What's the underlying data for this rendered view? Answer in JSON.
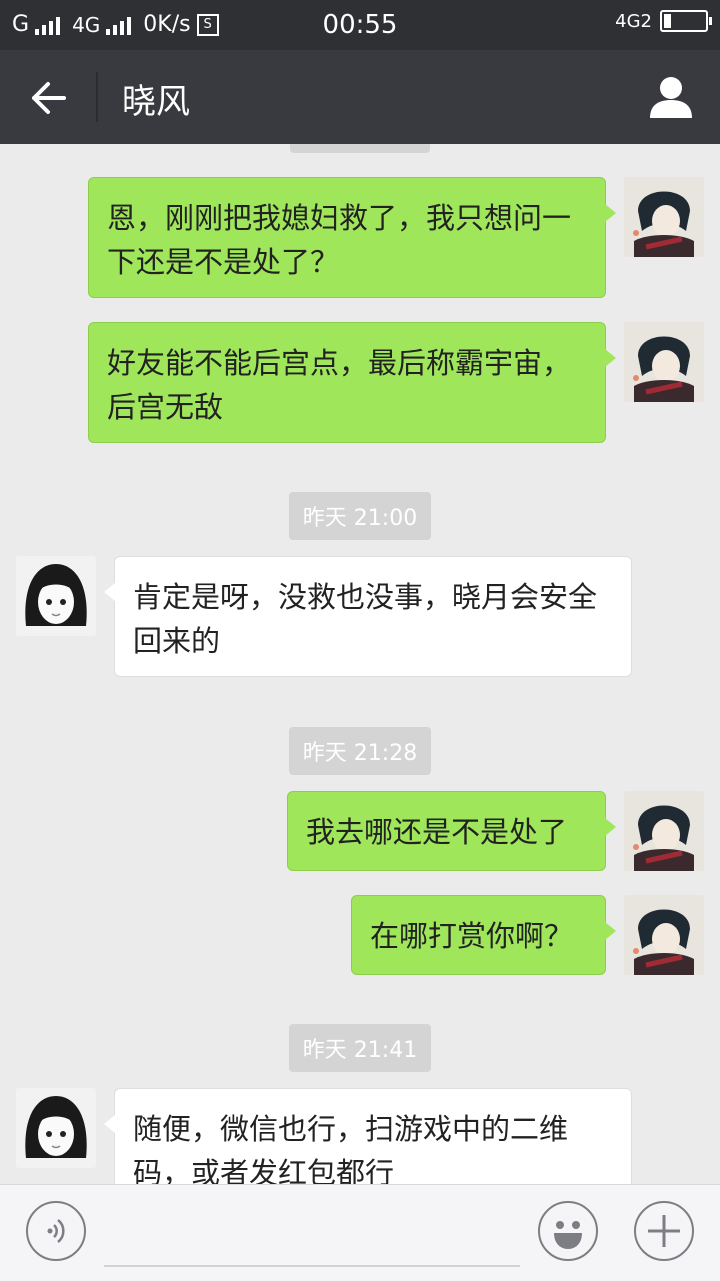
{
  "status_bar": {
    "carrier_left": "G",
    "net_type": "4G",
    "speed": "0K/s",
    "time": "00:55",
    "right_net": "4G2"
  },
  "header": {
    "back_icon": "arrow-left-icon",
    "title": "晓风",
    "profile_icon": "person-icon"
  },
  "messages": [
    {
      "side": "me",
      "text": "恩，刚刚把我媳妇救了，我只想问一下还是不是处了？"
    },
    {
      "side": "me",
      "text": "好友能不能后宫点，最后称霸宇宙，后宫无敌"
    },
    {
      "side": "time",
      "text": "昨天 21:00"
    },
    {
      "side": "them",
      "text": "肯定是呀，没救也没事，晓月会安全回来的"
    },
    {
      "side": "time",
      "text": "昨天 21:28"
    },
    {
      "side": "me",
      "text": "我去哪还是不是处了"
    },
    {
      "side": "me",
      "text": "在哪打赏你啊？"
    },
    {
      "side": "time",
      "text": "昨天 21:41"
    },
    {
      "side": "them",
      "text": "随便，微信也行，扫游戏中的二维码，或者发红包都行"
    }
  ],
  "input_bar": {
    "voice_icon": "voice-icon",
    "emoji_icon": "smiley-icon",
    "more_icon": "plus-icon"
  },
  "colors": {
    "sent_bubble": "#9fe65a",
    "received_bubble": "#ffffff",
    "nav_bg": "#393a3f",
    "chat_bg": "#ebebeb"
  }
}
